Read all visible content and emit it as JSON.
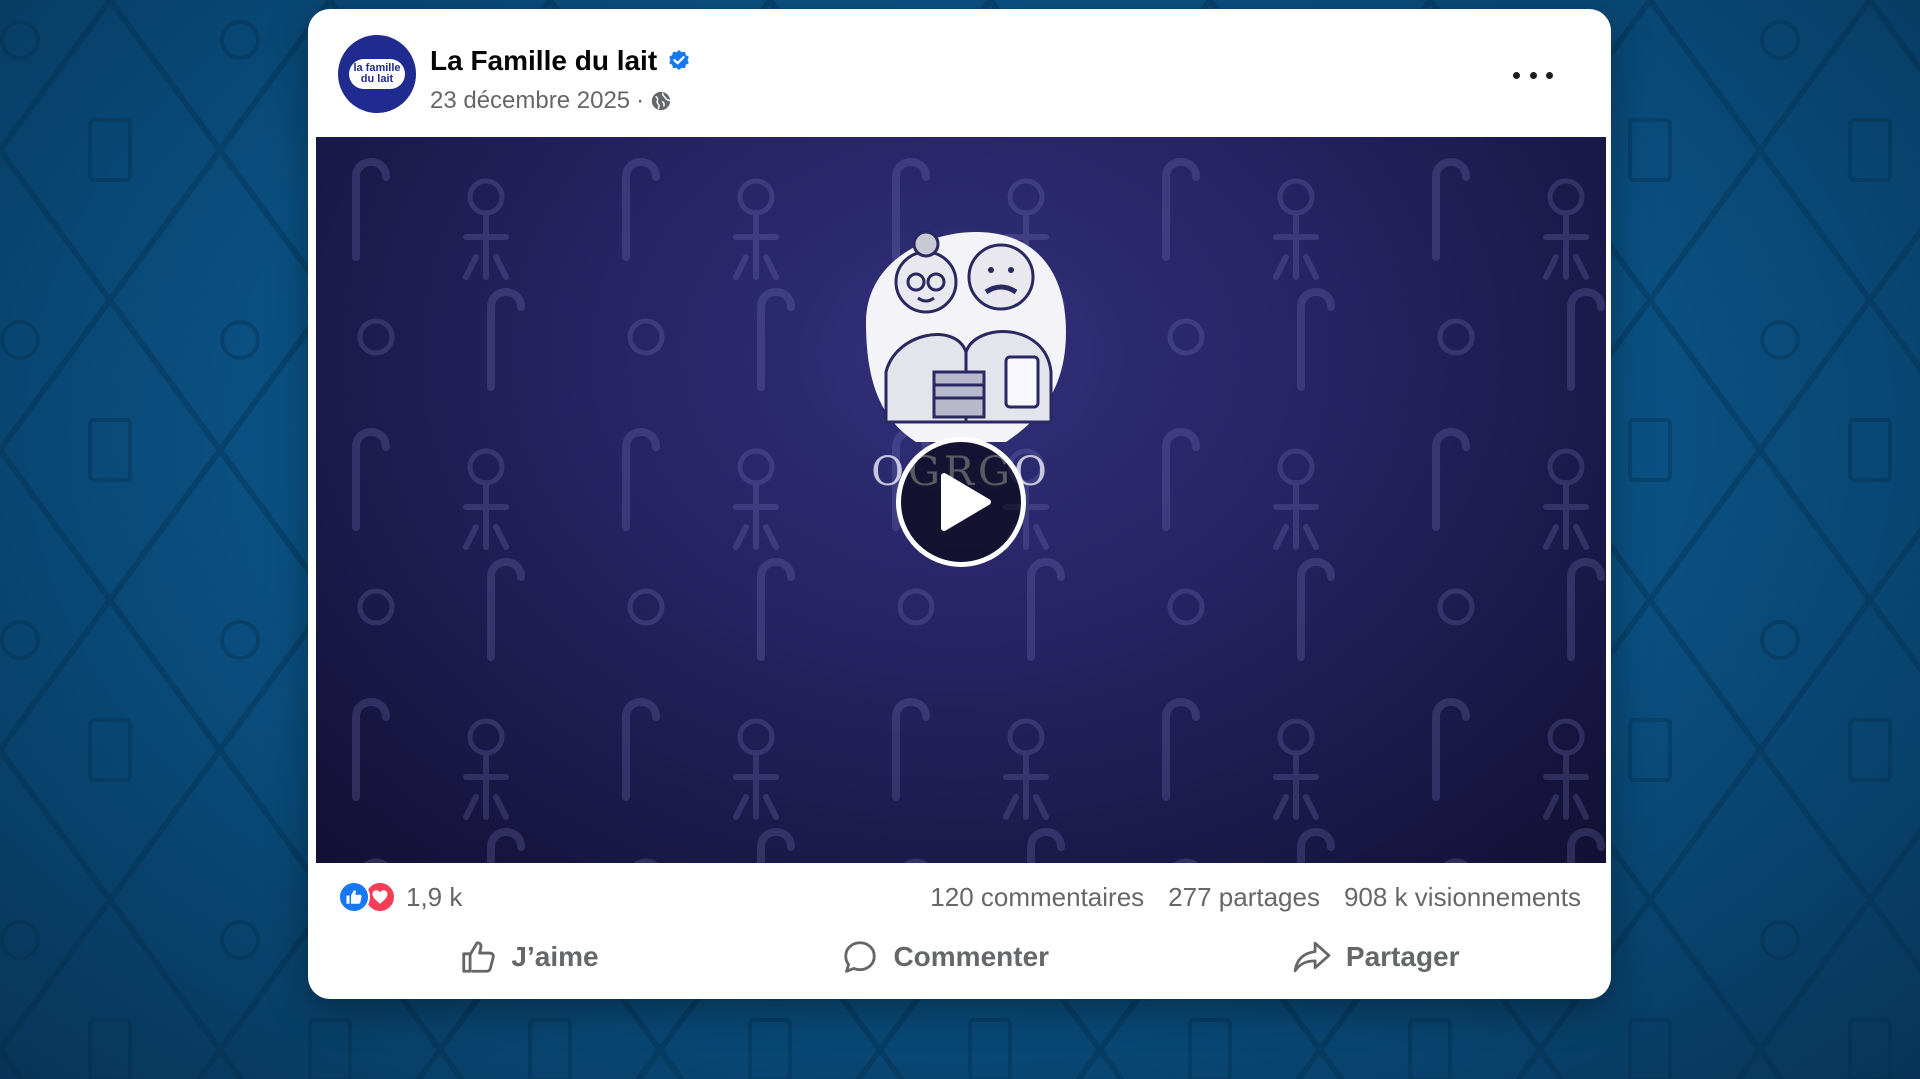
{
  "post": {
    "page_name": "La Famille du lait",
    "avatar_text_line1": "la famille",
    "avatar_text_line2": "du lait",
    "date": "23 décembre 2025",
    "separator": "·",
    "audience_icon": "globe-icon",
    "verified_icon": "verified-badge-icon",
    "more_icon": "more-options-icon"
  },
  "video": {
    "overlay_text": "OGRGO",
    "play_icon": "play-icon"
  },
  "stats": {
    "reaction_count": "1,9 k",
    "comments": "120 commentaires",
    "shares": "277 partages",
    "views": "908 k visionnements"
  },
  "actions": {
    "like_label": "J’aime",
    "comment_label": "Commenter",
    "share_label": "Partager"
  },
  "colors": {
    "brand_blue": "#1877f2",
    "love_red": "#f33e58",
    "video_bg": "#24225f",
    "page_bg": "#0b4f7a"
  }
}
